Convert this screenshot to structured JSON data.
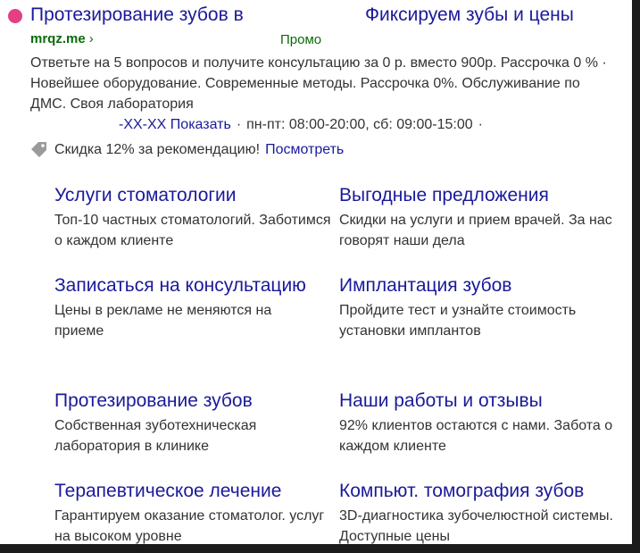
{
  "ad": {
    "title_left": "Протезирование зубов в",
    "title_right": "Фиксируем зубы и цены",
    "host": "mrqz.me",
    "host_chevron": "›",
    "promo_label": "Промо",
    "description": "Ответьте на 5 вопросов и получите консультацию за 0 р. вместо 900р. Рассрочка 0 % · Новейшее оборудование. Современные методы. Рассрочка 0%. Обслуживание по ДМС. Своя лаборатория",
    "contacts": {
      "phone_link": "-XX-XX Показать",
      "separator": "·",
      "hours": "пн-пт: 08:00-20:00, сб: 09:00-15:00",
      "trailing_separator": "·"
    },
    "promo": {
      "icon": "tag-icon",
      "text": "Скидка 12% за рекомендацию!",
      "link": "Посмотреть"
    }
  },
  "sitelinks": [
    {
      "title": "Услуги стоматологии",
      "desc": "Топ-10 частных стоматологий. Заботимся о каждом клиенте"
    },
    {
      "title": "Выгодные предложения",
      "desc": "Скидки на услуги и прием врачей. За нас говорят наши дела"
    },
    {
      "title": "Записаться на консультацию",
      "desc": "Цены в рекламе не меняются на приеме"
    },
    {
      "title": "Имплантация зубов",
      "desc": "Пройдите тест и узнайте стоимость установки имплантов"
    },
    {
      "title": "Протезирование зубов",
      "desc": "Собственная зуботехническая лаборатория в клинике"
    },
    {
      "title": "Наши работы и отзывы",
      "desc": "92% клиентов остаются с нами. Забота о каждом клиенте"
    },
    {
      "title": "Терапевтическое лечение",
      "desc": "Гарантируем оказание стоматолог. услуг на высоком уровне"
    },
    {
      "title": "Компьют. томография зубов",
      "desc": "3D-диагностика зубочелюстной системы. Доступные цены"
    }
  ],
  "colors": {
    "link": "#1a1a9a",
    "host": "#0a6b0a",
    "text": "#333333",
    "favicon": "#e4407f",
    "background": "#1b1b1b"
  }
}
